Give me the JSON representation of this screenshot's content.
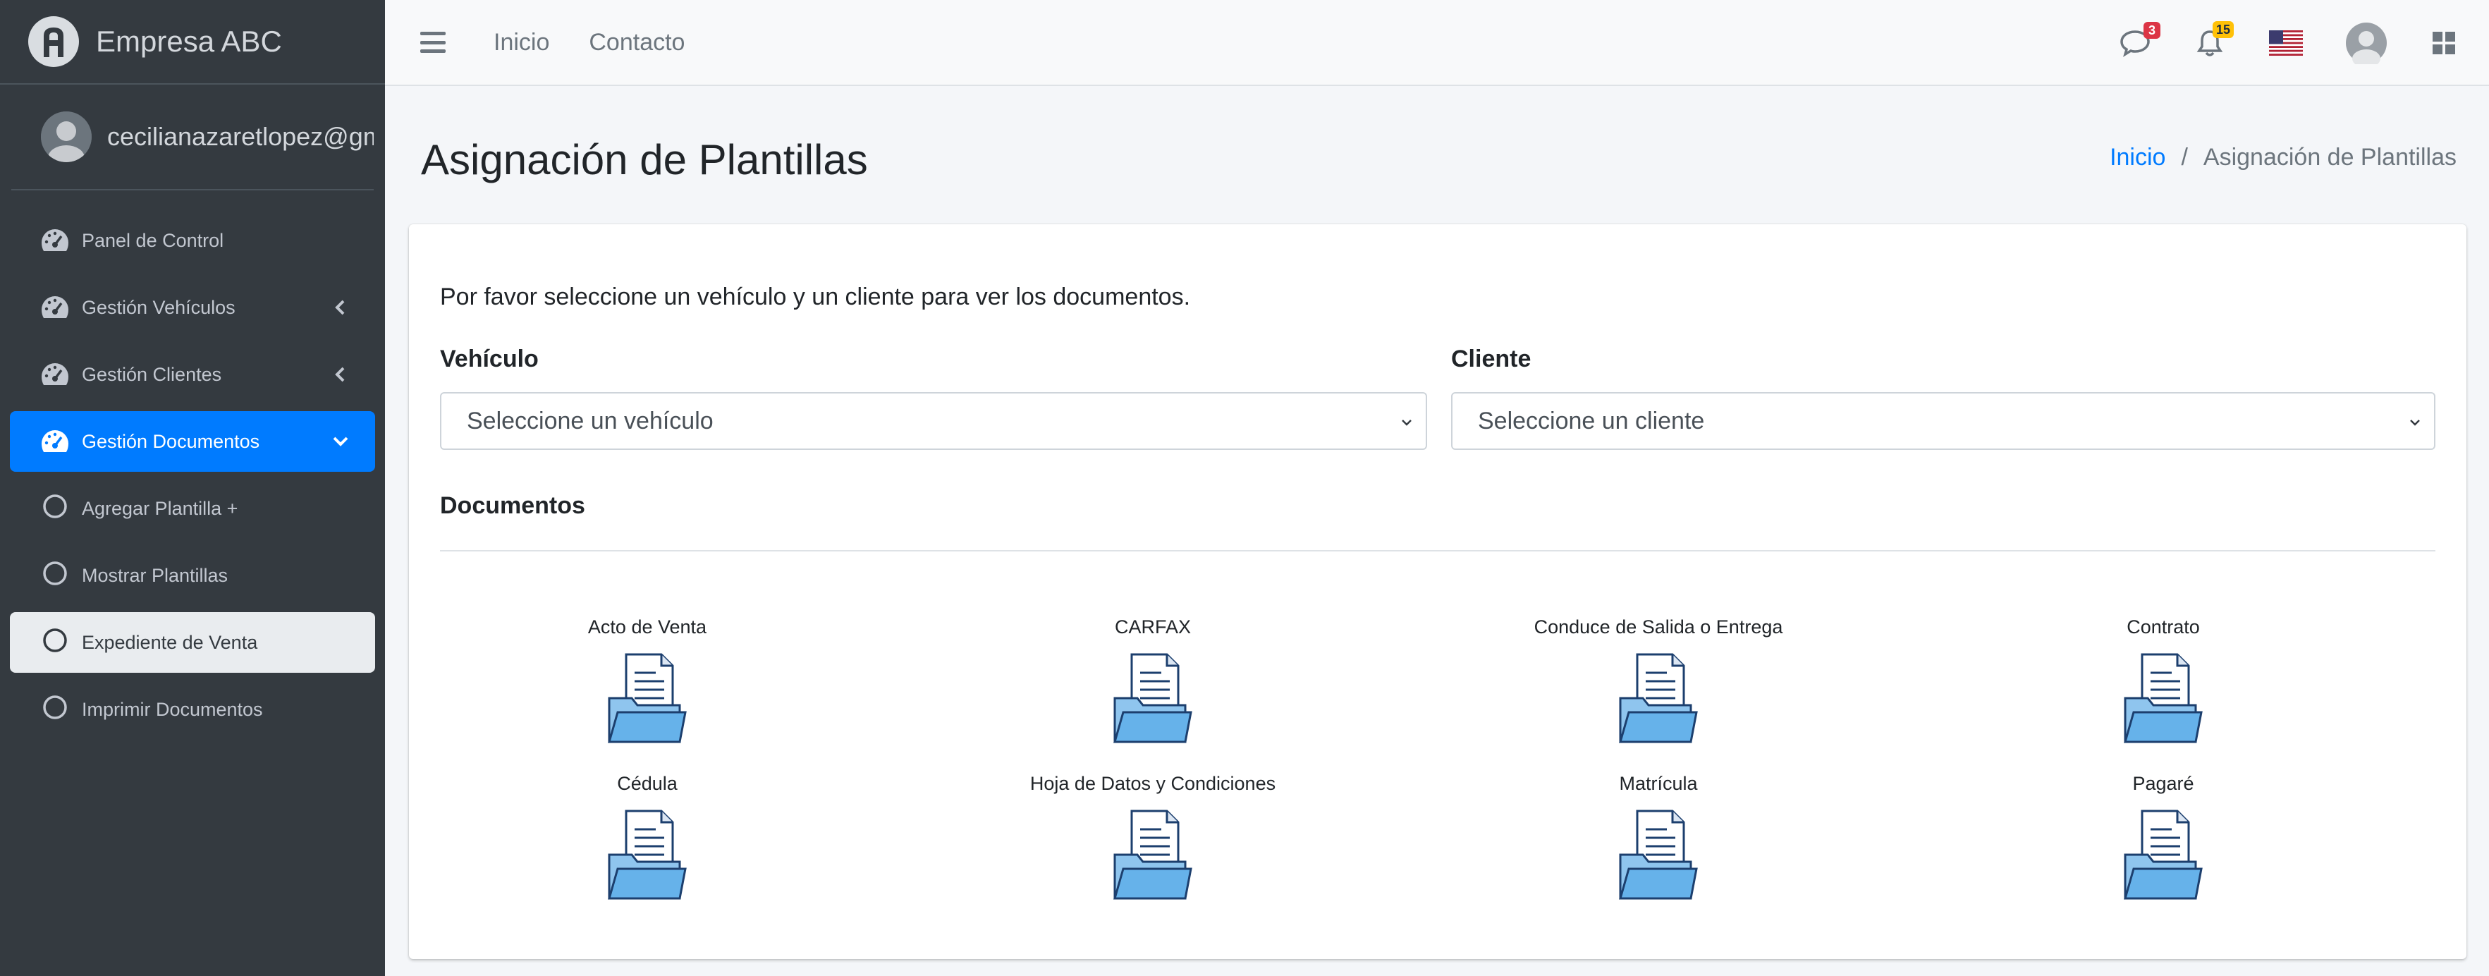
{
  "brand": {
    "name": "Empresa ABC"
  },
  "user": {
    "email": "cecilianazaretlopez@gmail.com"
  },
  "sidebar": {
    "items": [
      {
        "label": "Panel de Control"
      },
      {
        "label": "Gestión Vehículos"
      },
      {
        "label": "Gestión Clientes"
      },
      {
        "label": "Gestión Documentos"
      },
      {
        "label": "Agregar Plantilla +"
      },
      {
        "label": "Mostrar Plantillas"
      },
      {
        "label": "Expediente de Venta"
      },
      {
        "label": "Imprimir Documentos"
      }
    ]
  },
  "topbar": {
    "links": [
      {
        "label": "Inicio"
      },
      {
        "label": "Contacto"
      }
    ],
    "messages_count": "3",
    "notifications_count": "15"
  },
  "page": {
    "title": "Asignación de Plantillas",
    "breadcrumb": {
      "home": "Inicio",
      "separator": "/",
      "current": "Asignación de Plantillas"
    }
  },
  "card": {
    "intro": "Por favor seleccione un vehículo y un cliente para ver los documentos.",
    "vehicle": {
      "label": "Vehículo",
      "value": "Seleccione un vehículo"
    },
    "client": {
      "label": "Cliente",
      "value": "Seleccione un cliente"
    },
    "documents_title": "Documentos",
    "documents": [
      {
        "label": "Acto de Venta"
      },
      {
        "label": "CARFAX"
      },
      {
        "label": "Conduce de Salida o Entrega"
      },
      {
        "label": "Contrato"
      },
      {
        "label": "Cédula"
      },
      {
        "label": "Hoja de Datos y Condiciones"
      },
      {
        "label": "Matrícula"
      },
      {
        "label": "Pagaré"
      }
    ]
  },
  "colors": {
    "sidebar_bg": "#343a40",
    "active": "#007bff",
    "selected_bg": "#e9ecef",
    "link": "#007bff"
  }
}
